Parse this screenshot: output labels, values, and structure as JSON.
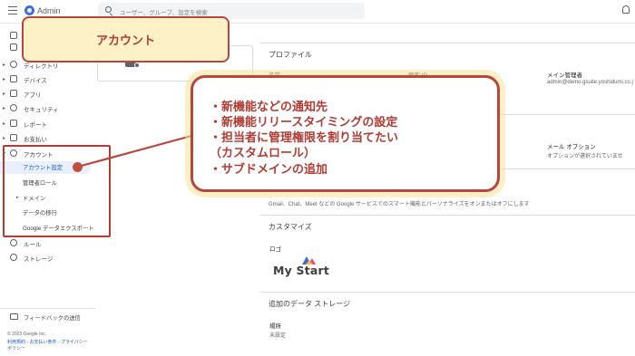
{
  "header": {
    "app_title": "Admin",
    "search_placeholder": "ユーザー、グループ、設定を検索"
  },
  "sidebar": {
    "items": [
      {
        "label": "ディレクトリ"
      },
      {
        "label": "デバイス"
      },
      {
        "label": "アプリ"
      },
      {
        "label": "セキュリティ"
      },
      {
        "label": "レポート"
      },
      {
        "label": "お支払い"
      },
      {
        "label": "アカウント"
      }
    ],
    "account_sub": [
      {
        "label": "アカウント設定"
      },
      {
        "label": "管理者ロール"
      },
      {
        "label": "ドメイン"
      },
      {
        "label": "データの移行"
      },
      {
        "label": "Google データエクスポート"
      }
    ],
    "after": [
      {
        "label": "ルール"
      },
      {
        "label": "ストレージ"
      }
    ],
    "feedback": "フィードバックの送信",
    "footer": {
      "copyright": "© 2023 Google Inc.",
      "links1": "利用規約 - お支払い条件 - プライバシー",
      "links2": "ポリシー"
    }
  },
  "profile_card": {
    "title": "プロファイル",
    "col1_key": "名前",
    "col2_key": "顧客 ID",
    "col3_key": "メイン管理者",
    "col3_value": "admin@demo.gsuite.yoshidumi.co.j",
    "mail_key": "メール オプション",
    "mail_value": "オプションが選択されていませ"
  },
  "personalize_text": "Gmail、Chat、Meet などの Google サービスでのスマート機能とパーソナライズをオンまたはオフにします",
  "customize_card": {
    "title": "カスタマイズ",
    "logo_key": "ロゴ",
    "brand": "My Start"
  },
  "storage_card": {
    "title": "追加のデータ ストレージ",
    "location_key": "場所",
    "location_value": "未設定"
  },
  "annotations": {
    "title_callout": "アカウント",
    "bullets": [
      "・新機能などの通知先",
      "・新機能リリースタイミングの設定",
      "・担当者に管理権限を割り当てたい",
      "（カスタムロール）",
      "・サブドメインの追加"
    ]
  },
  "colors": {
    "accent_red": "#b23b33",
    "callout_fill": "#fdf1c8",
    "brand_blue": "#3b6fd8"
  }
}
